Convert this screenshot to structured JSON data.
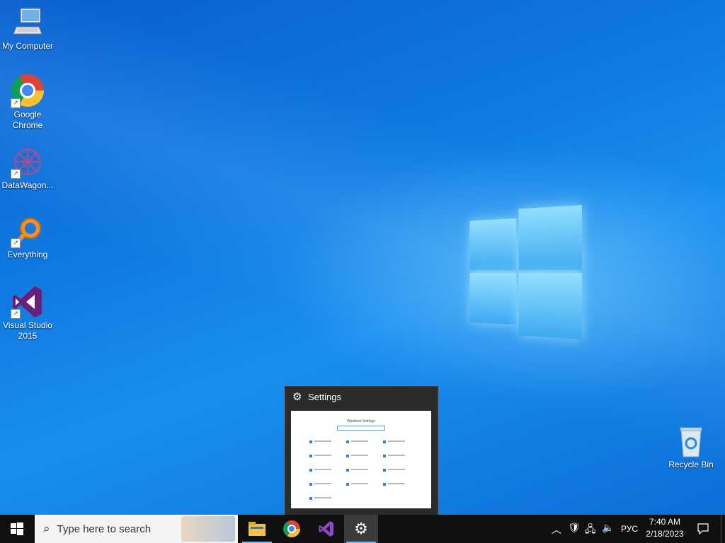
{
  "desktop": {
    "icons": [
      {
        "label": "My Computer",
        "icon": "computer-icon"
      },
      {
        "label": "Google Chrome",
        "icon": "chrome-icon"
      },
      {
        "label": "DataWagon...",
        "icon": "datawagon-icon"
      },
      {
        "label": "Everything",
        "icon": "everything-search-icon"
      },
      {
        "label": "Visual Studio 2015",
        "icon": "visual-studio-icon"
      },
      {
        "label": "Recycle Bin",
        "icon": "recycle-bin-icon"
      }
    ]
  },
  "preview": {
    "title": "Settings",
    "icon": "gear-icon",
    "thumbnail_heading": "Windows Settings"
  },
  "taskbar": {
    "search_placeholder": "Type here to search",
    "apps": [
      {
        "name": "File Explorer",
        "icon": "folder-icon",
        "active": true
      },
      {
        "name": "Google Chrome",
        "icon": "chrome-icon",
        "active": false
      },
      {
        "name": "Visual Studio",
        "icon": "visual-studio-icon",
        "active": false
      },
      {
        "name": "Settings",
        "icon": "gear-icon",
        "active": true
      }
    ],
    "tray": {
      "language": "РУС",
      "time": "7:40 AM",
      "date": "2/18/2023"
    }
  },
  "colors": {
    "desktop_blue": "#0e78e0",
    "taskbar": "#101010",
    "active_indicator": "#76b9ed"
  }
}
